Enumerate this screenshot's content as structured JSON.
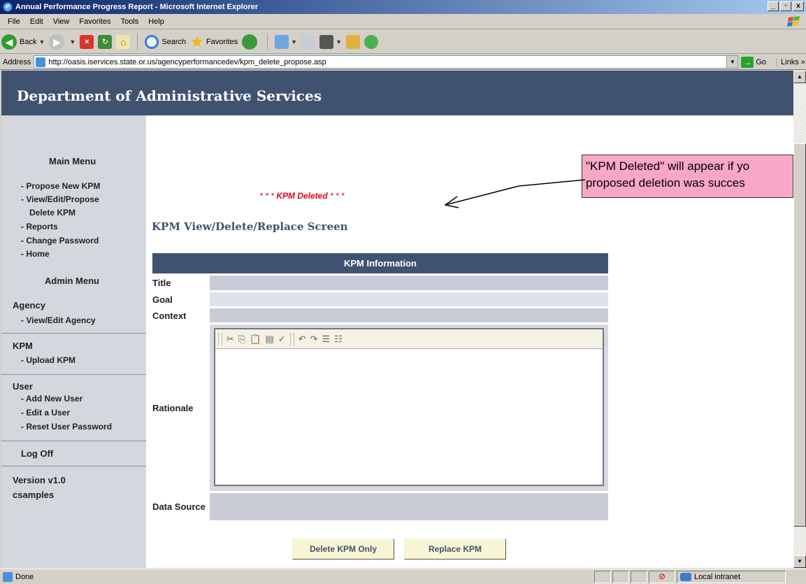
{
  "window": {
    "title": "Annual Performance Progress Report - Microsoft Internet Explorer",
    "controls": [
      "_",
      "▫",
      "x"
    ]
  },
  "menu": [
    "File",
    "Edit",
    "View",
    "Favorites",
    "Tools",
    "Help"
  ],
  "toolbar": {
    "back_label": "Back",
    "search_label": "Search",
    "favorites_label": "Favorites"
  },
  "address": {
    "label": "Address",
    "url": "http://oasis.iservices.state.or.us/agencyperformancedev/kpm_delete_propose.asp",
    "go_label": "Go",
    "links_label": "Links"
  },
  "page": {
    "banner_title": "Department of Administrative Services",
    "sidebar": {
      "main_menu_heading": "Main Menu",
      "main_links": [
        "- Propose New KPM",
        "- View/Edit/Propose",
        "Delete KPM",
        "- Reports",
        "- Change Password",
        "- Home"
      ],
      "admin_menu_heading": "Admin Menu",
      "agency_label": "Agency",
      "agency_links": [
        "- View/Edit Agency"
      ],
      "kpm_label": "KPM",
      "kpm_links": [
        "- Upload KPM"
      ],
      "user_label": "User",
      "user_links": [
        "- Add New User",
        "- Edit a User",
        "- Reset User Password"
      ],
      "logoff_label": "Log Off",
      "version_label": "Version v1.0",
      "username": "csamples"
    },
    "message": {
      "stars_left": "* * * ",
      "text": "KPM Deleted",
      "stars_right": " * * *"
    },
    "screen_title": "KPM View/Delete/Replace Screen",
    "kpm_table": {
      "header": "KPM Information",
      "rows": [
        {
          "label": "Title",
          "value": ""
        },
        {
          "label": "Goal",
          "value": ""
        },
        {
          "label": "Context",
          "value": ""
        },
        {
          "label": "Rationale",
          "value": ""
        },
        {
          "label": "Data Source",
          "value": ""
        }
      ]
    },
    "editor_toolbar_icons": [
      "scissors-icon",
      "copy-icon",
      "paste-icon",
      "paste-word-icon",
      "spellcheck-icon",
      "undo-icon",
      "redo-icon",
      "ordered-list-icon",
      "unordered-list-icon"
    ],
    "buttons": {
      "delete_kpm": "Delete KPM Only",
      "replace_kpm": "Replace KPM"
    },
    "callout": {
      "line1": "\"KPM Deleted\" will appear if yo",
      "line2": "proposed deletion was succes"
    }
  },
  "status": {
    "text": "Done",
    "zone": "Local intranet"
  },
  "colors": {
    "banner": "#3f5371",
    "sidebar": "#d5d7de",
    "deleted_message": "#e2001a",
    "callout": "#f9a7c7",
    "button_face": "#f8f5d2"
  }
}
